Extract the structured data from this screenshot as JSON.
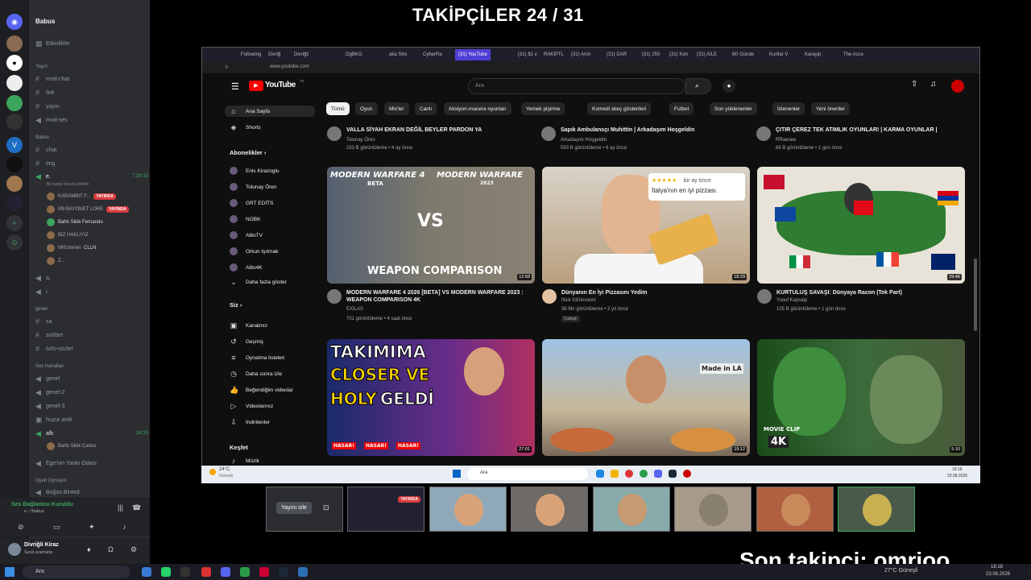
{
  "overlay": {
    "followers": "TAKİPÇİLER 24 / 31",
    "last_follower": "Son takipçi: omrioo"
  },
  "discord": {
    "server": "Babus",
    "events": "Etkinlikler",
    "cat1": "Yayın",
    "ch1": [
      "mod-chat",
      "link",
      "yayın",
      "mod-ses"
    ],
    "cat2": "Babus",
    "ch2": [
      "chat",
      "img"
    ],
    "voice1": {
      "name": "e.",
      "time": "7:29:33",
      "status": "Bir kanal durumu belirle"
    },
    "users": [
      "KARAMBIT F...",
      "M9 BAYONET LORE",
      "Bahtı Sikik Fernando",
      "BİZ HAKLIYIZ",
      "MrErdenet",
      "Z..."
    ],
    "live": "YAYINDA",
    "cllm": "CLLN",
    "ch3": [
      "a.",
      "i."
    ],
    "cat3": "genel",
    "ch4": [
      "sa",
      "sohbet",
      "özlü-sözler"
    ],
    "cat4": "Ses Kanalları",
    "ch5": [
      "genel",
      "genel-2",
      "genel-3",
      "huzur amk"
    ],
    "afk": "afk",
    "afk_time": "38:33",
    "afk_user": "Bahtı Sikik Carlos",
    "ch6": "Ege'nin Yankı Odası",
    "cat5": "Oyun Oynuyor",
    "game_user": "Boğos Binted",
    "voice_status": "Ses Bağlantısı Kuruldu",
    "voice_sub": "e. / Babus",
    "me": "Divriğli Kiraz",
    "me_status": "Sesli aramada"
  },
  "browser": {
    "tabs": [
      "Following",
      "Divriğ",
      "Divriğli",
      "OgBKG",
      "aka Stre",
      "CyberRa",
      "(31) YouTube",
      "(31) $1 v",
      "RAKIPTL",
      "(31) Arch",
      "(31) DAR",
      "(31) 250",
      "(31) Kon",
      "(31) AİLE",
      "B0 Günde",
      "Kurtlar V",
      "Karayip",
      "The Acce"
    ],
    "url": "www.youtube.com"
  },
  "yt": {
    "logo": "YouTube",
    "logo_sup": "TR",
    "search_placeholder": "Ara",
    "chips": [
      "Tümü",
      "Oyun",
      "Mix'ler",
      "Canlı",
      "Aksiyon-macera oyunları",
      "Yemek pişirme",
      "Komedi skeç gösterileri",
      "Futbol",
      "Son yüklenenler",
      "İzlenenler",
      "Yeni öneriler"
    ],
    "side": {
      "home": "Ana Sayfa",
      "shorts": "Shorts",
      "subs_header": "Abonelikler",
      "subs": [
        "Enis Kirazoglu",
        "Tolunay Ören",
        "GRT EDİTS",
        "NOBK",
        "AlitoTV",
        "Orkun Işıtmak",
        "Alito4K"
      ],
      "more": "Daha fazla göster",
      "you": "Siz",
      "you_items": [
        "Kanalınız",
        "Geçmiş",
        "Oynatma listeleri",
        "Daha sonra izle",
        "Beğendiğim videolar",
        "Videolarınız",
        "İndirilenler"
      ],
      "explore": "Keşfet",
      "music": "Müzik"
    },
    "top": [
      {
        "title": "VALLA SİYAH EKRAN DEĞİL BEYLER PARDON YA",
        "channel": "Tolunay Ören",
        "meta": "153 B görüntüleme • 4 ay önce"
      },
      {
        "title": "Sapık Ambulansçı Muhittin | Arkadaşım Hoşgeldin",
        "channel": "Arkadaşım Hoşgeldin",
        "meta": "593 B görüntüleme • 6 ay önce"
      },
      {
        "title": "ÇITIR ÇEREZ TEK ATIMLIK OYUNLAR! | KARMA OYUNLAR |",
        "channel": "RRaenee",
        "meta": "88 B görüntüleme • 1 gün önce"
      }
    ],
    "videos": [
      {
        "title": "MODERN WARFARE 4 2026 [BETA] VS MODERN WARFARE 2023 : WEAPON COMPARISON 4K",
        "channel": "EXILAS",
        "meta": "701 görüntüleme • 4 saat önce",
        "dur": "12:58",
        "t1": "MODERN WARFARE 4",
        "t2": "MODERN WARFARE",
        "t3": "VS",
        "t4": "WEAPON COMPARISON",
        "beta": "BETA",
        "year": "2023"
      },
      {
        "title": "Dünyanın En İyi Pizzasını Yedim",
        "channel": "Nick DiGiovanni",
        "meta": "36 Mn görüntüleme • 2 yıl önce",
        "dur": "18:29",
        "sub": "Dublajlı",
        "stars": "★★★★★",
        "ago": "bir ay önce",
        "quote": "İtalya'nın en iyi pizzası."
      },
      {
        "title": "KURTULUŞ SAVAŞI: Dünyaya Racon (Tek Part)",
        "channel": "Yusuf Kaysalp",
        "meta": "105 B görüntüleme • 1 gün önce",
        "dur": "29:46"
      },
      {
        "title": "",
        "dur": "27:01",
        "t1": "TAKIMIMA",
        "t2": "CLOSER VE",
        "t3": "HOLY",
        "t4": "GELDİ",
        "hit": "HASAR!"
      },
      {
        "title": "",
        "dur": "19:12",
        "sign": "Made in LA"
      },
      {
        "title": "",
        "dur": "5:10",
        "clip": "MOVIE CLIP",
        "k": "4K"
      }
    ]
  },
  "wintask": {
    "weather": "24°C",
    "weather_sub": "Güneşli",
    "search": "Ara",
    "time": "18:18",
    "date": "23.08.2026"
  },
  "cams": {
    "watch": "Yayını izle",
    "live": "YAYINDA"
  },
  "taskbar": {
    "search": "Ara",
    "weather": "27°C Güneşli",
    "time": "18:18",
    "date": "23.08.2026"
  },
  "colors": {
    "discord_bg": "#2b2d31",
    "live": "#d83c3e",
    "yt_bg": "#0f0f0f",
    "accent": "#4f3fd6"
  }
}
